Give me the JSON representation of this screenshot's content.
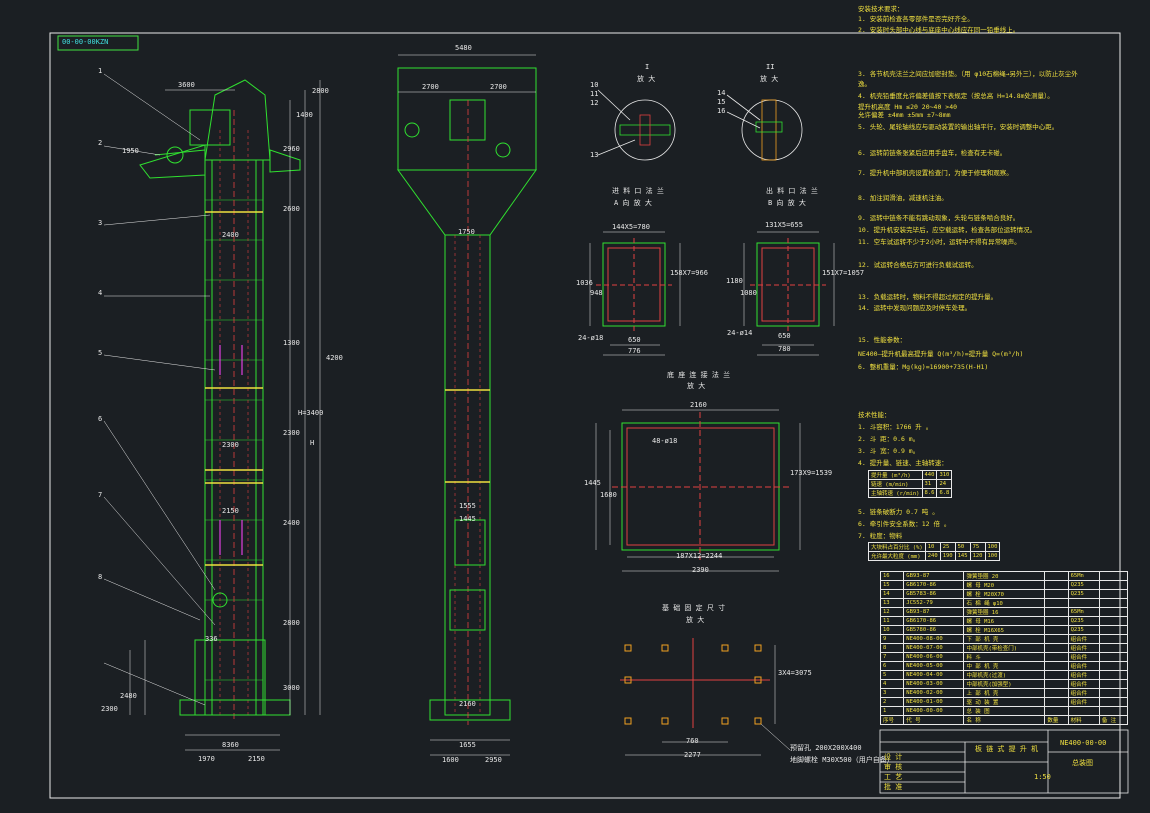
{
  "frame_code": "00-00-00KZN",
  "left_elevation": {
    "part_numbers": [
      "1",
      "2",
      "3",
      "4",
      "5",
      "6",
      "7",
      "8"
    ],
    "dims": [
      "3600",
      "2800",
      "1400",
      "2960",
      "1950",
      "2600",
      "2400",
      "4200",
      "2300",
      "1300",
      "2300",
      "2400",
      "H=3400",
      "3000",
      "2800",
      "2150",
      "2300",
      "H",
      "2400",
      "336",
      "2150",
      "8360",
      "1970",
      "2150",
      "2480",
      "2300"
    ]
  },
  "mid_elevation": {
    "dims": [
      "5480",
      "2700",
      "2700",
      "1750",
      "1555",
      "1445",
      "2160",
      "1655",
      "1600",
      "2950"
    ]
  },
  "detail_I": {
    "roman": "I",
    "label": "放 大",
    "parts": [
      "10",
      "11",
      "12",
      "13"
    ]
  },
  "detail_II": {
    "roman": "II",
    "label": "放 大",
    "parts": [
      "14",
      "15",
      "16"
    ]
  },
  "inlet_flange": {
    "title": "进 料 口 法 兰",
    "subtitle": "A 向 放 大",
    "top_dim": "144X5=780",
    "left_dims": [
      "1036",
      "948"
    ],
    "right_dim": "158X7=966",
    "bolts": "24-ø18",
    "bottom_dims": [
      "650",
      "776"
    ]
  },
  "outlet_flange": {
    "title": "出 料 口 法 兰",
    "subtitle": "B 向 放 大",
    "top_dim": "131X5=655",
    "left_dims": [
      "1180",
      "1080"
    ],
    "right_dim": "151X7=1057",
    "bolts": "24-ø14",
    "bottom_dims": [
      "650",
      "780"
    ]
  },
  "base_flange": {
    "title": "底 座 连 接 法 兰",
    "subtitle": "放 大",
    "top_dim": "2160",
    "bolts": "48-ø18",
    "left_dims": [
      "1445",
      "1680"
    ],
    "right_dim": "173X9=1539",
    "bottom_dims": [
      "187X12=2244",
      "2390"
    ]
  },
  "anchor_plan": {
    "title": "基 础 固 定 尺 寸",
    "subtitle": "放 大",
    "right_dim": "3X4=3075",
    "bottom_dims": [
      "760",
      "2277"
    ],
    "notes": [
      "预留孔  200X200X400",
      "地脚螺栓  M30X500（用户自备）"
    ]
  },
  "install_notes": [
    "安装技术要求：",
    "1. 安装前检查各零部件是否完好齐全。",
    "2. 安装时头部中心线与底座中心线应在同一铅垂线上。",
    "3. 各节机壳法兰之间应加密封垫。（用 φ10石棉绳→另外三），以防止灰尘外",
    "逸。",
    "4. 机壳铅垂度允许偏差值按下表规定（按总高 H=14.8m处测量）。",
    "提升机高度 Hm   ≤20   20~40   >40",
    "允许偏差       ±4mm   ±5mm   ±7~8mm",
    "5. 头轮、尾轮轴线应与驱动装置的输出轴平行，安装时调整中心距。",
    "6. 运转前链条张紧后应用手盘车，检查有无卡碰。",
    "7. 提升机中部机壳设置检查门，为便于修理和观察。",
    "8. 加注润滑油，减速机注油。",
    "9. 运转中链条不能有跳动现象，头轮与链条啮合良好。",
    "10. 提升机安装完毕后，应空载运转，检查各部位运转情况。",
    "11. 空车试运转不少于2小时，运转中不得有异常噪声。",
    "12. 试运转合格后方可进行负载试运转。",
    "13. 负载运转时，物料不得超过规定的提升量。",
    "14. 运转中发现问题应及时停车处理。",
    "15. 性能参数：",
    "NE400—提升机最高提升量 Q(m³/h)=提升量 Q=(m³/h)",
    "6. 整机重量：Mg(kg)=16900+735(H-H1)"
  ],
  "tech_perf": {
    "title": "技术性能：",
    "items": [
      "1. 斗容积：1766 升 。",
      "2. 斗    距：0.6 m。",
      "3. 斗    宽：0.9 m。",
      "4. 提升量、链速、主轴转速："
    ],
    "table_rows": [
      [
        "提升量  (m³/h)",
        "440",
        "310"
      ],
      [
        "链速  (m/min)",
        "31",
        "24"
      ],
      [
        "主轴转速 (r/min)",
        "8.6",
        "6.8"
      ]
    ],
    "extra": [
      "5. 链条破断力 0.7 吨 。",
      "6. 牵引件安全系数：12 倍 。",
      "7. 粒度：物料"
    ],
    "particle_rows": [
      [
        "大块料占百分比 (%)",
        "10",
        "25",
        "50",
        "75",
        "100"
      ],
      [
        "允许最大粒度 (mm)",
        "240",
        "190",
        "145",
        "120",
        "100"
      ]
    ]
  },
  "bom_rows": [
    [
      "16",
      "GB93-87",
      "弹簧垫圈 20",
      "",
      "65Mn",
      ""
    ],
    [
      "15",
      "GB6170-86",
      "螺   母  M20",
      "",
      "Q235",
      ""
    ],
    [
      "14",
      "GB5783-86",
      "螺   栓  M20X70",
      "",
      "Q235",
      ""
    ],
    [
      "13",
      "JC552-79",
      "石 棉 绳  φ10",
      "",
      "",
      ""
    ],
    [
      "12",
      "GB93-87",
      "弹簧垫圈  16",
      "",
      "65Mn",
      ""
    ],
    [
      "11",
      "GB6170-86",
      "螺   母  M16",
      "",
      "Q235",
      ""
    ],
    [
      "10",
      "GB5780-86",
      "螺   栓  M16X65",
      "",
      "Q235",
      ""
    ],
    [
      "9",
      "NE400-08-00",
      "下 部 机 壳",
      "",
      "组合件",
      ""
    ],
    [
      "8",
      "NE400-07-00",
      "中部机壳(带检查门)",
      "",
      "组合件",
      ""
    ],
    [
      "7",
      "NE400-06-00",
      "料  斗",
      "",
      "组合件",
      ""
    ],
    [
      "6",
      "NE400-05-00",
      "中 部 机 壳",
      "",
      "组合件",
      ""
    ],
    [
      "5",
      "NE400-04-00",
      "中部机壳(过渡)",
      "",
      "组合件",
      ""
    ],
    [
      "4",
      "NE400-03-00",
      "中部机壳(加强型)",
      "",
      "组合件",
      ""
    ],
    [
      "3",
      "NE400-02-00",
      "上 部 机 壳",
      "",
      "组合件",
      ""
    ],
    [
      "2",
      "NE400-01-00",
      "驱 动 装 置",
      "",
      "组合件",
      ""
    ],
    [
      "1",
      "NE400-00-00",
      "总  装  图",
      "",
      "",
      ""
    ]
  ],
  "bom_header": [
    "序号",
    "代  号",
    "名    称",
    "数量",
    "材料",
    "备 注"
  ],
  "bom_remark": "用户自备",
  "title_block": {
    "drawing_no": "NE400-00-00",
    "name": "板 链 式 提 升 机",
    "drawing_kind": "总装图",
    "scale": "1:50",
    "rows": [
      "设 计",
      "审 核",
      "工 艺",
      "批 准"
    ]
  }
}
